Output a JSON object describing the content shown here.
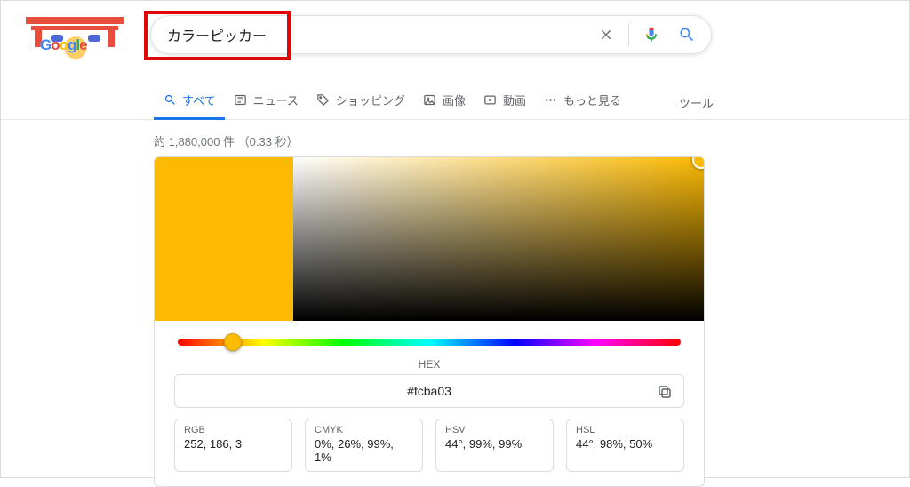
{
  "search": {
    "query": "カラーピッカー"
  },
  "logo": {
    "letters": [
      "G",
      "o",
      "o",
      "g",
      "l",
      "e"
    ]
  },
  "tabs": {
    "all": "すべて",
    "news": "ニュース",
    "shopping": "ショッピング",
    "images": "画像",
    "videos": "動画",
    "more": "もっと見る",
    "tools": "ツール"
  },
  "stats": "約 1,880,000 件 （0.33 秒）",
  "picker": {
    "selected_color": "#fcba03",
    "hue_percent": 11,
    "hex_label": "HEX",
    "hex_value": "#fcba03",
    "rgb_label": "RGB",
    "rgb_value": "252, 186, 3",
    "cmyk_label": "CMYK",
    "cmyk_value": "0%, 26%, 99%, 1%",
    "hsv_label": "HSV",
    "hsv_value": "44°, 99%, 99%",
    "hsl_label": "HSL",
    "hsl_value": "44°, 98%, 50%"
  }
}
